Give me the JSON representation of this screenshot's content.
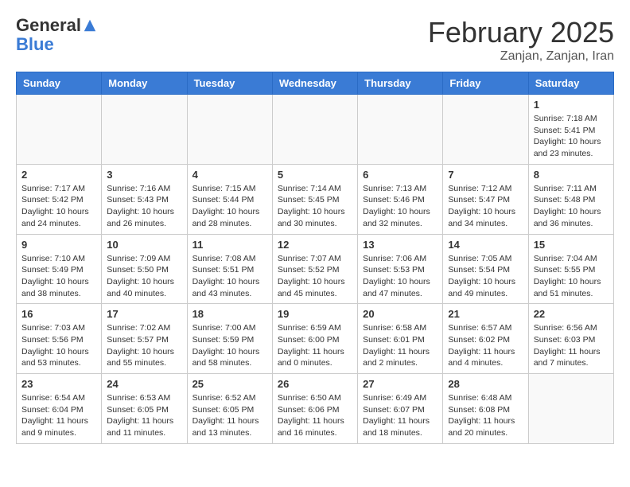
{
  "header": {
    "logo_line1": "General",
    "logo_line2": "Blue",
    "month_title": "February 2025",
    "subtitle": "Zanjan, Zanjan, Iran"
  },
  "days_of_week": [
    "Sunday",
    "Monday",
    "Tuesday",
    "Wednesday",
    "Thursday",
    "Friday",
    "Saturday"
  ],
  "weeks": [
    [
      {
        "day": "",
        "info": ""
      },
      {
        "day": "",
        "info": ""
      },
      {
        "day": "",
        "info": ""
      },
      {
        "day": "",
        "info": ""
      },
      {
        "day": "",
        "info": ""
      },
      {
        "day": "",
        "info": ""
      },
      {
        "day": "1",
        "info": "Sunrise: 7:18 AM\nSunset: 5:41 PM\nDaylight: 10 hours and 23 minutes."
      }
    ],
    [
      {
        "day": "2",
        "info": "Sunrise: 7:17 AM\nSunset: 5:42 PM\nDaylight: 10 hours and 24 minutes."
      },
      {
        "day": "3",
        "info": "Sunrise: 7:16 AM\nSunset: 5:43 PM\nDaylight: 10 hours and 26 minutes."
      },
      {
        "day": "4",
        "info": "Sunrise: 7:15 AM\nSunset: 5:44 PM\nDaylight: 10 hours and 28 minutes."
      },
      {
        "day": "5",
        "info": "Sunrise: 7:14 AM\nSunset: 5:45 PM\nDaylight: 10 hours and 30 minutes."
      },
      {
        "day": "6",
        "info": "Sunrise: 7:13 AM\nSunset: 5:46 PM\nDaylight: 10 hours and 32 minutes."
      },
      {
        "day": "7",
        "info": "Sunrise: 7:12 AM\nSunset: 5:47 PM\nDaylight: 10 hours and 34 minutes."
      },
      {
        "day": "8",
        "info": "Sunrise: 7:11 AM\nSunset: 5:48 PM\nDaylight: 10 hours and 36 minutes."
      }
    ],
    [
      {
        "day": "9",
        "info": "Sunrise: 7:10 AM\nSunset: 5:49 PM\nDaylight: 10 hours and 38 minutes."
      },
      {
        "day": "10",
        "info": "Sunrise: 7:09 AM\nSunset: 5:50 PM\nDaylight: 10 hours and 40 minutes."
      },
      {
        "day": "11",
        "info": "Sunrise: 7:08 AM\nSunset: 5:51 PM\nDaylight: 10 hours and 43 minutes."
      },
      {
        "day": "12",
        "info": "Sunrise: 7:07 AM\nSunset: 5:52 PM\nDaylight: 10 hours and 45 minutes."
      },
      {
        "day": "13",
        "info": "Sunrise: 7:06 AM\nSunset: 5:53 PM\nDaylight: 10 hours and 47 minutes."
      },
      {
        "day": "14",
        "info": "Sunrise: 7:05 AM\nSunset: 5:54 PM\nDaylight: 10 hours and 49 minutes."
      },
      {
        "day": "15",
        "info": "Sunrise: 7:04 AM\nSunset: 5:55 PM\nDaylight: 10 hours and 51 minutes."
      }
    ],
    [
      {
        "day": "16",
        "info": "Sunrise: 7:03 AM\nSunset: 5:56 PM\nDaylight: 10 hours and 53 minutes."
      },
      {
        "day": "17",
        "info": "Sunrise: 7:02 AM\nSunset: 5:57 PM\nDaylight: 10 hours and 55 minutes."
      },
      {
        "day": "18",
        "info": "Sunrise: 7:00 AM\nSunset: 5:59 PM\nDaylight: 10 hours and 58 minutes."
      },
      {
        "day": "19",
        "info": "Sunrise: 6:59 AM\nSunset: 6:00 PM\nDaylight: 11 hours and 0 minutes."
      },
      {
        "day": "20",
        "info": "Sunrise: 6:58 AM\nSunset: 6:01 PM\nDaylight: 11 hours and 2 minutes."
      },
      {
        "day": "21",
        "info": "Sunrise: 6:57 AM\nSunset: 6:02 PM\nDaylight: 11 hours and 4 minutes."
      },
      {
        "day": "22",
        "info": "Sunrise: 6:56 AM\nSunset: 6:03 PM\nDaylight: 11 hours and 7 minutes."
      }
    ],
    [
      {
        "day": "23",
        "info": "Sunrise: 6:54 AM\nSunset: 6:04 PM\nDaylight: 11 hours and 9 minutes."
      },
      {
        "day": "24",
        "info": "Sunrise: 6:53 AM\nSunset: 6:05 PM\nDaylight: 11 hours and 11 minutes."
      },
      {
        "day": "25",
        "info": "Sunrise: 6:52 AM\nSunset: 6:05 PM\nDaylight: 11 hours and 13 minutes."
      },
      {
        "day": "26",
        "info": "Sunrise: 6:50 AM\nSunset: 6:06 PM\nDaylight: 11 hours and 16 minutes."
      },
      {
        "day": "27",
        "info": "Sunrise: 6:49 AM\nSunset: 6:07 PM\nDaylight: 11 hours and 18 minutes."
      },
      {
        "day": "28",
        "info": "Sunrise: 6:48 AM\nSunset: 6:08 PM\nDaylight: 11 hours and 20 minutes."
      },
      {
        "day": "",
        "info": ""
      }
    ]
  ]
}
